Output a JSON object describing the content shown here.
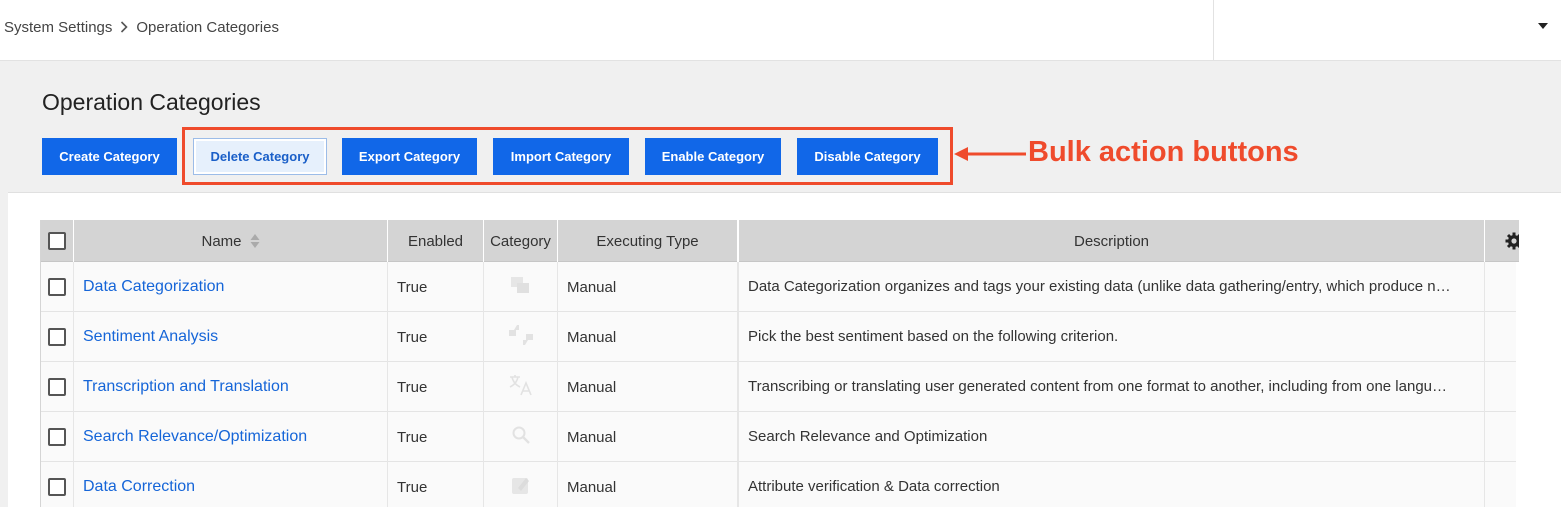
{
  "breadcrumb": {
    "items": [
      "System Settings",
      "Operation Categories"
    ]
  },
  "page": {
    "title": "Operation Categories"
  },
  "toolbar": {
    "buttons": [
      {
        "label": "Create Category",
        "style": "primary"
      },
      {
        "label": "Delete Category",
        "style": "light"
      },
      {
        "label": "Export Category",
        "style": "primary"
      },
      {
        "label": "Import Category",
        "style": "primary"
      },
      {
        "label": "Enable Category",
        "style": "primary"
      },
      {
        "label": "Disable Category",
        "style": "primary"
      }
    ]
  },
  "annotation": {
    "text": "Bulk action buttons",
    "color": "#ef4b2c"
  },
  "table": {
    "columns": [
      "Name",
      "Enabled",
      "Category",
      "Executing Type",
      "Description"
    ],
    "rows": [
      {
        "name": "Data Categorization",
        "enabled": "True",
        "category_icon": "categorization-icon",
        "executing_type": "Manual",
        "description": "Data Categorization organizes and tags your existing data (unlike data gathering/entry, which produce n…"
      },
      {
        "name": "Sentiment Analysis",
        "enabled": "True",
        "category_icon": "thumbs-up-down-icon",
        "executing_type": "Manual",
        "description": "Pick the best sentiment based on the following criterion."
      },
      {
        "name": "Transcription and Translation",
        "enabled": "True",
        "category_icon": "translate-icon",
        "executing_type": "Manual",
        "description": "Transcribing or translating user generated content from one format to another, including from one langu…"
      },
      {
        "name": "Search Relevance/Optimization",
        "enabled": "True",
        "category_icon": "search-icon",
        "executing_type": "Manual",
        "description": "Search Relevance and Optimization"
      },
      {
        "name": "Data Correction",
        "enabled": "True",
        "category_icon": "edit-square-icon",
        "executing_type": "Manual",
        "description": "Attribute verification & Data correction"
      }
    ]
  },
  "colors": {
    "primary_button": "#1167e8",
    "link": "#1565d8",
    "annotation": "#ef4b2c"
  }
}
